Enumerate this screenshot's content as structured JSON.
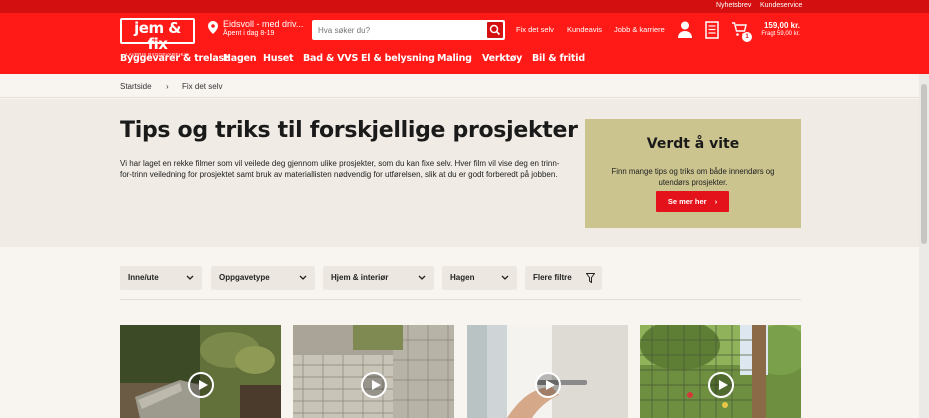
{
  "top_links": {
    "newsletter": "Nyhetsbrev",
    "customer_service": "Kundeservice"
  },
  "header": {
    "logo_text": "jem & fix",
    "logo_subtext": "LAVPRIS BYGGEVAREHUS",
    "store_name": "Eidsvoll - med driv...",
    "store_hours": "Åpent i dag 8-19",
    "search_placeholder": "Hva søker du?",
    "links": {
      "fix": "Fix det selv",
      "flyer": "Kundeavis",
      "jobs": "Jobb & karriere"
    },
    "cart_count": "1",
    "cart_total": "159,00 kr.",
    "cart_freight": "Fragt 59,00 kr."
  },
  "categories": [
    "Byggevarer & trelast",
    "Hagen",
    "Huset",
    "Bad & VVS",
    "El & belysning",
    "Maling",
    "Verktøy",
    "Bil & fritid"
  ],
  "breadcrumb": {
    "home": "Startside",
    "separator": "›",
    "current": "Fix det selv"
  },
  "hero": {
    "title": "Tips og triks til forskjellige prosjekter",
    "intro": "Vi har laget en rekke filmer som vil veilede deg gjennom ulike prosjekter, som du kan fixe selv. Hver film vil vise deg en trinn-for-trinn veiledning for prosjektet samt bruk av materiallisten nødvendig for utførelsen, slik at du er godt forberedt på jobben."
  },
  "infobox": {
    "title": "Verdt å vite",
    "text": "Finn mange tips og triks om både innendørs og utendørs prosjekter.",
    "button": "Se mer her"
  },
  "filters": [
    "Inne/ute",
    "Oppgavetype",
    "Hjem & interiør",
    "Hagen",
    "Flere filtre"
  ],
  "colors": {
    "brand_red": "#ff1a17",
    "dark_red": "#d30f0f",
    "infobox_bg": "#cbc48f",
    "button_red": "#e3121b"
  }
}
